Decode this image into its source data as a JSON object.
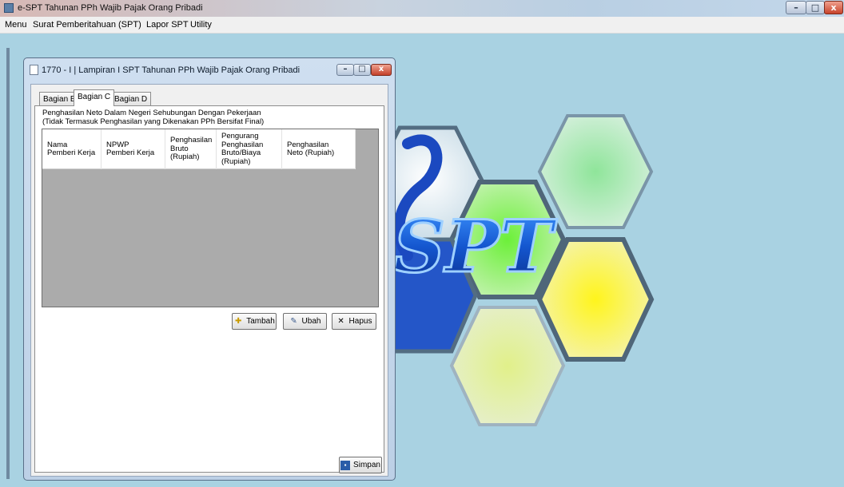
{
  "app": {
    "title": "e-SPT Tahunan PPh Wajib Pajak Orang Pribadi",
    "icon": "app-icon"
  },
  "window_controls": {
    "minimize": "–",
    "maximize": "□",
    "close": "x"
  },
  "menu": [
    "Menu",
    "Surat Pemberitahuan (SPT)",
    "Lapor SPT",
    "Utility"
  ],
  "child": {
    "title": "1770 - I | Lampiran I SPT Tahunan PPh Wajib Pajak Orang Pribadi",
    "controls": {
      "minimize": "–",
      "maximize": "□",
      "close": "x"
    },
    "tabs": [
      {
        "label": "Bagian B",
        "active": false
      },
      {
        "label": "Bagian C",
        "active": true
      },
      {
        "label": "Bagian D",
        "active": false
      }
    ],
    "description_line1": "Penghasilan Neto Dalam Negeri Sehubungan Dengan Pekerjaan",
    "description_line2": "(Tidak Termasuk Penghasilan yang Dikenakan PPh Bersifat Final)",
    "columns": [
      "Nama\nPemberi Kerja",
      "NPWP\nPemberi Kerja",
      "Penghasilan\nBruto (Rupiah)",
      "Pengurang\nPenghasilan\nBruto/Biaya\n(Rupiah)",
      "Penghasilan\nNeto (Rupiah)"
    ],
    "rows": [],
    "buttons": {
      "add": "Tambah",
      "edit": "Ubah",
      "delete": "Hapus",
      "save": "Simpan"
    }
  },
  "background_logo_text": "SPT",
  "colors": {
    "desktop": "#a9d2e2",
    "grid_bg": "#ababab",
    "logo_blue": "#1b5fd0"
  }
}
